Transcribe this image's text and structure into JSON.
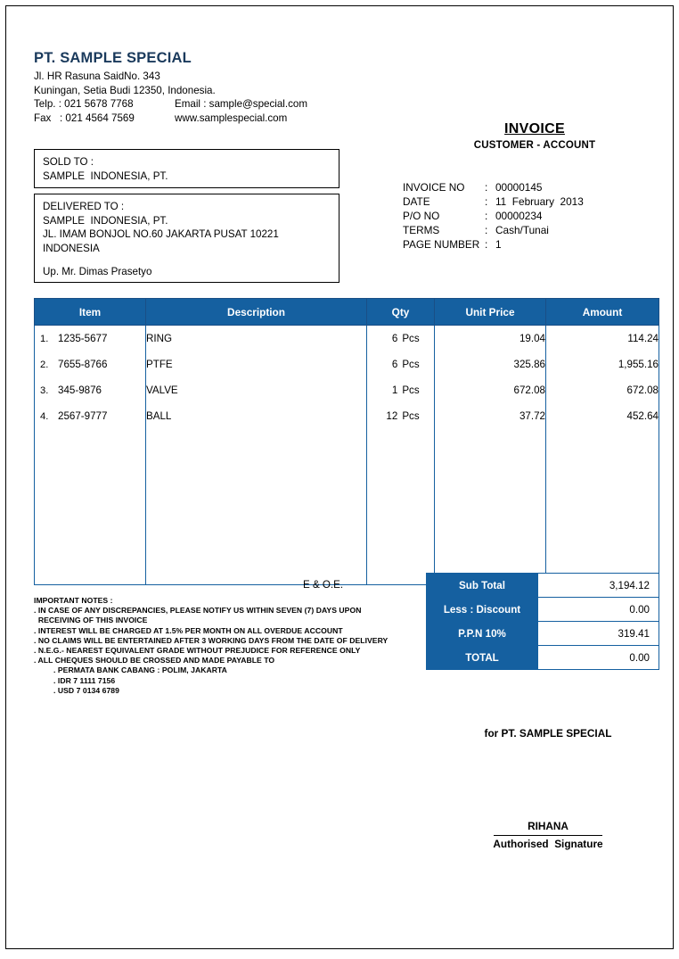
{
  "company": {
    "name": "PT. SAMPLE SPECIAL",
    "address_line1": "Jl. HR Rasuna SaidNo. 343",
    "address_line2": "Kuningan, Setia Budi 12350, Indonesia.",
    "telp_label": "Telp. : 021 5678 7768",
    "email_label": "Email : sample@special.com",
    "fax_label": "Fax   : 021 4564 7569",
    "website_label": "www.samplespecial.com"
  },
  "invoice": {
    "title": "INVOICE",
    "subtitle": "CUSTOMER - ACCOUNT"
  },
  "meta": [
    {
      "label": "INVOICE NO",
      "colon": ":",
      "value": "00000145"
    },
    {
      "label": "DATE",
      "colon": ":",
      "value": "11  February  2013"
    },
    {
      "label": "P/O NO",
      "colon": ":",
      "value": "00000234"
    },
    {
      "label": "TERMS",
      "colon": ":",
      "value": "Cash/Tunai"
    },
    {
      "label": "PAGE NUMBER",
      "colon": ":",
      "value": "1"
    }
  ],
  "sold_to": {
    "heading": "SOLD TO :",
    "line1": "SAMPLE  INDONESIA, PT."
  },
  "delivered_to": {
    "heading": "DELIVERED TO :",
    "line1": "SAMPLE  INDONESIA, PT.",
    "line2": "JL. IMAM BONJOL NO.60 JAKARTA PUSAT 10221",
    "line3": "INDONESIA",
    "line4": "Up. Mr. Dimas Prasetyo"
  },
  "table": {
    "headers": {
      "item": "Item",
      "description": "Description",
      "qty": "Qty",
      "unit_price": "Unit Price",
      "amount": "Amount"
    },
    "rows": [
      {
        "no": "1.",
        "code": "1235-5677",
        "description": "RING",
        "qty": "6",
        "unit": "Pcs",
        "unit_price": "19.04",
        "amount": "114.24"
      },
      {
        "no": "2.",
        "code": "7655-8766",
        "description": "PTFE",
        "qty": "6",
        "unit": "Pcs",
        "unit_price": "325.86",
        "amount": "1,955.16"
      },
      {
        "no": "3.",
        "code": "345-9876",
        "description": "VALVE",
        "qty": "1",
        "unit": "Pcs",
        "unit_price": "672.08",
        "amount": "672.08"
      },
      {
        "no": "4.",
        "code": "2567-9777",
        "description": "BALL",
        "qty": "12",
        "unit": "Pcs",
        "unit_price": "37.72",
        "amount": "452.64"
      }
    ]
  },
  "eoe": "E & O.E.",
  "totals": [
    {
      "label": "Sub Total",
      "value": "3,194.12"
    },
    {
      "label": "Less : Discount",
      "value": "0.00"
    },
    {
      "label": "P.P.N 10%",
      "value": "319.41"
    },
    {
      "label": "TOTAL",
      "value": "0.00"
    }
  ],
  "notes": {
    "heading": "IMPORTANT NOTES :",
    "lines": [
      ". IN CASE OF ANY DISCREPANCIES, PLEASE NOTIFY US WITHIN SEVEN (7) DAYS UPON",
      "  RECEIVING OF THIS INVOICE",
      ". INTEREST WILL BE CHARGED AT 1.5% PER MONTH ON ALL OVERDUE ACCOUNT",
      ". NO CLAIMS WILL BE ENTERTAINED AFTER 3 WORKING DAYS FROM THE DATE OF DELIVERY",
      ". N.E.G.- NEAREST EQUIVALENT GRADE WITHOUT PREJUDICE FOR REFERENCE ONLY",
      ". ALL CHEQUES SHOULD BE CROSSED AND MADE PAYABLE TO"
    ],
    "bank_lines": [
      ". PERMATA BANK CABANG : POLIM, JAKARTA",
      ". IDR 7 1111 7156",
      ". USD 7 0134 6789"
    ]
  },
  "signature": {
    "for_line": "for PT. SAMPLE SPECIAL",
    "name": "RIHANA",
    "caption": "Authorised  Signature"
  },
  "colors": {
    "header_blue": "#1560a0",
    "company_navy": "#1a3a5c"
  }
}
